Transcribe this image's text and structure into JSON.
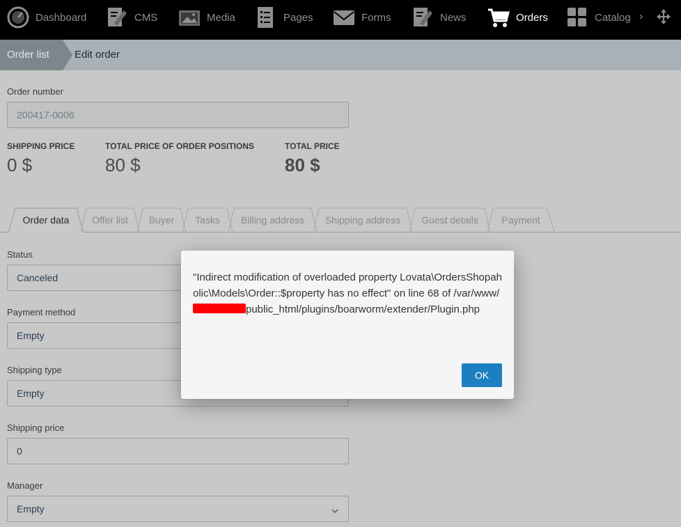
{
  "nav": {
    "items": [
      {
        "label": "Dashboard",
        "icon": "dashboard-icon"
      },
      {
        "label": "CMS",
        "icon": "cms-icon"
      },
      {
        "label": "Media",
        "icon": "media-icon"
      },
      {
        "label": "Pages",
        "icon": "pages-icon"
      },
      {
        "label": "Forms",
        "icon": "forms-icon"
      },
      {
        "label": "News",
        "icon": "news-icon"
      },
      {
        "label": "Orders",
        "icon": "cart-icon"
      },
      {
        "label": "Catalog",
        "icon": "catalog-icon"
      }
    ],
    "active": "Orders",
    "more": "›"
  },
  "breadcrumb": {
    "first": "Order list",
    "second": "Edit order"
  },
  "order": {
    "number_label": "Order number",
    "number_value": "200417-0006",
    "shipping_price_label": "SHIPPING PRICE",
    "shipping_price_value": "0 $",
    "positions_label": "TOTAL PRICE OF ORDER POSITIONS",
    "positions_value": "80 $",
    "total_label": "TOTAL PRICE",
    "total_value": "80 $"
  },
  "tabs": [
    "Order data",
    "Offer list",
    "Buyer",
    "Tasks",
    "Billing address",
    "Shipping address",
    "Guest details",
    "Payment"
  ],
  "form": {
    "status_label": "Status",
    "status_value": "Canceled",
    "payment_label": "Payment method",
    "payment_value": "Empty",
    "shipping_type_label": "Shipping type",
    "shipping_type_value": "Empty",
    "shipping_price_label": "Shipping price",
    "shipping_price_value": "0",
    "manager_label": "Manager",
    "manager_value": "Empty"
  },
  "modal": {
    "msg_part1": "\"Indirect modification of overloaded property Lovata\\OrdersShopaholic\\Models\\Order::$property has no effect\" on line 68 of /var/www/",
    "msg_part2": "public_html/plugins/boarworm/extender/Plugin.php",
    "ok_label": "OK"
  },
  "colors": {
    "nav_bg": "#000000",
    "breadcrumb_active": "#7c868c",
    "ok_button": "#1c7fc0",
    "redaction": "#ff0000"
  }
}
